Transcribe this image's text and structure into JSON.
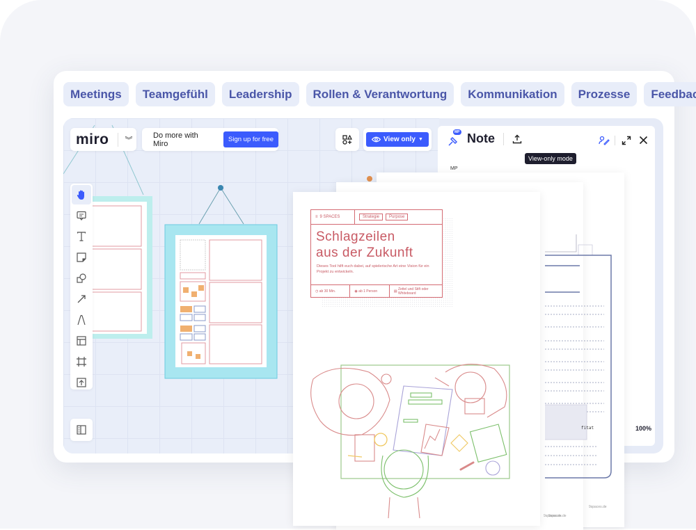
{
  "tabs": [
    "Meetings",
    "Teamgefühl",
    "Leadership",
    "Rollen & Verantwortung",
    "Kommunikation",
    "Prozesse",
    "Feedback"
  ],
  "board": {
    "logo": "miro",
    "promo_text": "Do more with Miro",
    "signup_label": "Sign up for free",
    "view_mode_label": "View only",
    "toolbar_tools": [
      "hand-tool",
      "comment-tool",
      "text-tool",
      "sticky-note-tool",
      "shapes-tool",
      "connector-tool",
      "pen-tool",
      "templates-tool",
      "frame-tool",
      "upload-tool"
    ],
    "active_tool": "hand-tool"
  },
  "note_panel": {
    "avatar_badge": "MP",
    "title": "Note",
    "tooltip": "View-only mode",
    "author_initials": "MP",
    "zoom_level": "100%"
  },
  "handout": {
    "brand": "9 SPACES",
    "tag1": "Strategie",
    "tag2": "Purpose",
    "title_line1": "Schlagzeilen",
    "title_line2": "aus der Zukunft",
    "description": "Dieses Tool hilft euch dabei, auf spielerische Art eine Vision für ein Projekt zu entwickeln.",
    "duration": "ab 30 Min.",
    "participants": "ab 1 Person",
    "materials": "Zettel und Stift oder Whiteboard",
    "footer": "9spaces.de",
    "sidebar_word": "fitat"
  },
  "colors": {
    "accent": "#3b5bfd",
    "tab_text": "#4a56a8",
    "tab_bg": "#e8edf9",
    "handout_red": "#c85a64",
    "frame_teal": "#9fe3e6"
  }
}
